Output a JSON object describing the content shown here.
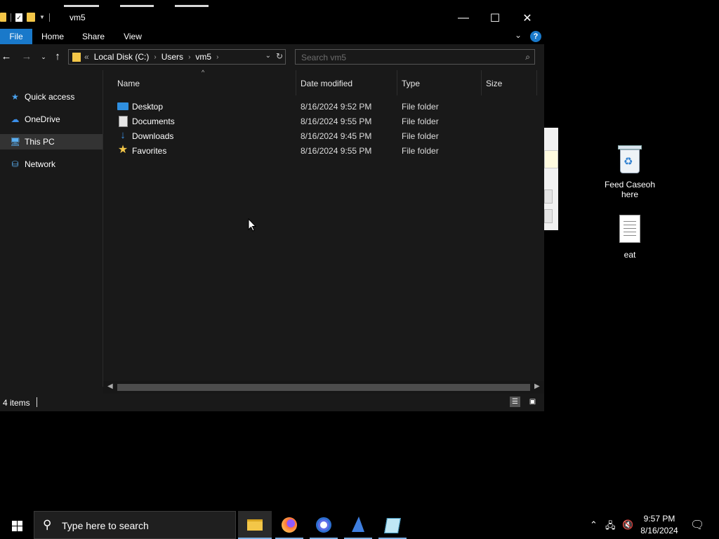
{
  "window": {
    "title": "vm5"
  },
  "ribbon": {
    "tabs": [
      "File",
      "Home",
      "Share",
      "View"
    ],
    "help": "?"
  },
  "navbar": {
    "breadcrumb_overflow": "«",
    "breadcrumb": [
      "Local Disk (C:)",
      "Users",
      "vm5"
    ],
    "search_placeholder": "Search vm5"
  },
  "nav_pane": {
    "items": [
      {
        "label": "Quick access"
      },
      {
        "label": "OneDrive"
      },
      {
        "label": "This PC",
        "selected": true
      },
      {
        "label": "Network"
      }
    ]
  },
  "columns": [
    "Name",
    "Date modified",
    "Type",
    "Size"
  ],
  "files": [
    {
      "name": "Desktop",
      "date": "8/16/2024 9:52 PM",
      "type": "File folder",
      "icon": "desktop-folder-icon"
    },
    {
      "name": "Documents",
      "date": "8/16/2024 9:55 PM",
      "type": "File folder",
      "icon": "documents-folder-icon"
    },
    {
      "name": "Downloads",
      "date": "8/16/2024 9:45 PM",
      "type": "File folder",
      "icon": "downloads-folder-icon"
    },
    {
      "name": "Favorites",
      "date": "8/16/2024 9:55 PM",
      "type": "File folder",
      "icon": "favorites-folder-icon"
    }
  ],
  "status": {
    "item_count": "4 items"
  },
  "desktop": {
    "icons": [
      {
        "label": "Feed Caseoh here",
        "icon": "recycle-bin-icon"
      },
      {
        "label": "eat",
        "icon": "text-document-icon"
      }
    ]
  },
  "taskbar": {
    "search_placeholder": "Type here to search",
    "time": "9:57 PM",
    "date": "8/16/2024"
  },
  "colors": {
    "accent": "#1979ca",
    "folder": "#f3c648",
    "window_bg": "#191919"
  }
}
